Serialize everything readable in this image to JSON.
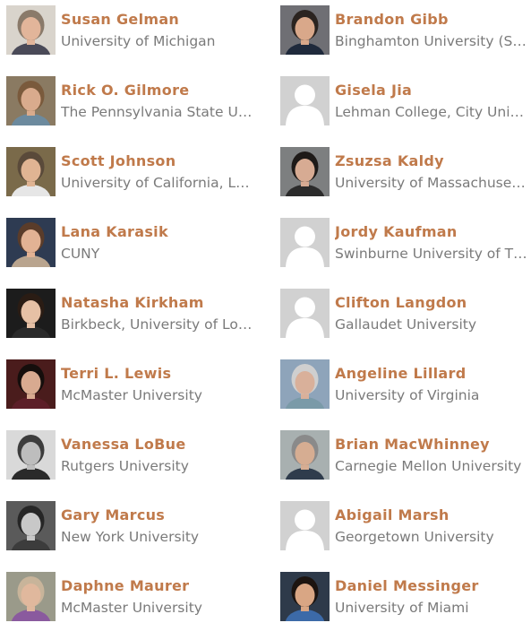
{
  "people": [
    {
      "name": "Susan Gelman",
      "affiliation": "University of Michigan",
      "photo": "portrait",
      "bg": "#d9d4cc",
      "skin": "#e2b59a",
      "hair": "#8a7a6a",
      "shirt": "#4a4a58"
    },
    {
      "name": "Brandon Gibb",
      "affiliation": "Binghamton University (S…",
      "photo": "portrait",
      "bg": "#6f6f74",
      "skin": "#d9a88a",
      "hair": "#2b2420",
      "shirt": "#1f2a3c"
    },
    {
      "name": "Rick O. Gilmore",
      "affiliation": "The Pennsylvania State Un…",
      "photo": "portrait",
      "bg": "#8a7a62",
      "skin": "#d9ab8d",
      "hair": "#7a5a3c",
      "shirt": "#6c8a9e"
    },
    {
      "name": "Gisela Jia",
      "affiliation": "Lehman College, City Uni…",
      "photo": "placeholder-avatar-icon"
    },
    {
      "name": "Scott Johnson",
      "affiliation": "University of California, L…",
      "photo": "portrait",
      "bg": "#7a6a4a",
      "skin": "#e0b493",
      "hair": "#5a4a3a",
      "shirt": "#e6e6e6"
    },
    {
      "name": "Zsuzsa Kaldy",
      "affiliation": "University of Massachuset…",
      "photo": "portrait",
      "bg": "#7d7f80",
      "skin": "#d7ab93",
      "hair": "#1e1a18",
      "shirt": "#2b2b2b"
    },
    {
      "name": "Lana Karasik",
      "affiliation": "CUNY",
      "photo": "portrait",
      "bg": "#2e3b52",
      "skin": "#e2b294",
      "hair": "#5a3c2a",
      "shirt": "#b9a48e"
    },
    {
      "name": "Jordy Kaufman",
      "affiliation": "Swinburne University of T…",
      "photo": "placeholder-avatar-icon"
    },
    {
      "name": "Natasha Kirkham",
      "affiliation": "Birkbeck, University of Lo…",
      "photo": "portrait",
      "bg": "#1c1c1c",
      "skin": "#e6c0a5",
      "hair": "#2a1c14",
      "shirt": "#2a2a2a"
    },
    {
      "name": "Clifton Langdon",
      "affiliation": "Gallaudet University",
      "photo": "placeholder-avatar-icon"
    },
    {
      "name": "Terri L. Lewis",
      "affiliation": "McMaster University",
      "photo": "portrait",
      "bg": "#4a1c1c",
      "skin": "#d8aa90",
      "hair": "#150e0c",
      "shirt": "#5c1e28"
    },
    {
      "name": "Angeline Lillard",
      "affiliation": "University of Virginia",
      "photo": "portrait",
      "bg": "#8ea4ba",
      "skin": "#d9b09a",
      "hair": "#cfcfcf",
      "shirt": "#7a9aa8"
    },
    {
      "name": "Vanessa LoBue",
      "affiliation": "Rutgers University",
      "photo": "portrait",
      "bg": "#d9d9d9",
      "skin": "#bdbdbd",
      "hair": "#3c3c3c",
      "shirt": "#2a2a2a"
    },
    {
      "name": "Brian MacWhinney",
      "affiliation": "Carnegie Mellon University",
      "photo": "portrait",
      "bg": "#a8b0b0",
      "skin": "#d6ad92",
      "hair": "#8a8a8a",
      "shirt": "#2f3c4c"
    },
    {
      "name": "Gary Marcus",
      "affiliation": "New York University",
      "photo": "portrait",
      "bg": "#5a5a5a",
      "skin": "#c8c8c8",
      "hair": "#262626",
      "shirt": "#3c3c3c"
    },
    {
      "name": "Abigail Marsh",
      "affiliation": "Georgetown University",
      "photo": "placeholder-avatar-icon"
    },
    {
      "name": "Daphne Maurer",
      "affiliation": "McMaster University",
      "photo": "portrait",
      "bg": "#9a9a8a",
      "skin": "#e0b89d",
      "hair": "#c8b49a",
      "shirt": "#8a5a9e"
    },
    {
      "name": "Daniel Messinger",
      "affiliation": "University of Miami",
      "photo": "portrait",
      "bg": "#2e3a4a",
      "skin": "#d9a684",
      "hair": "#1c1410",
      "shirt": "#3c6aa8"
    }
  ]
}
